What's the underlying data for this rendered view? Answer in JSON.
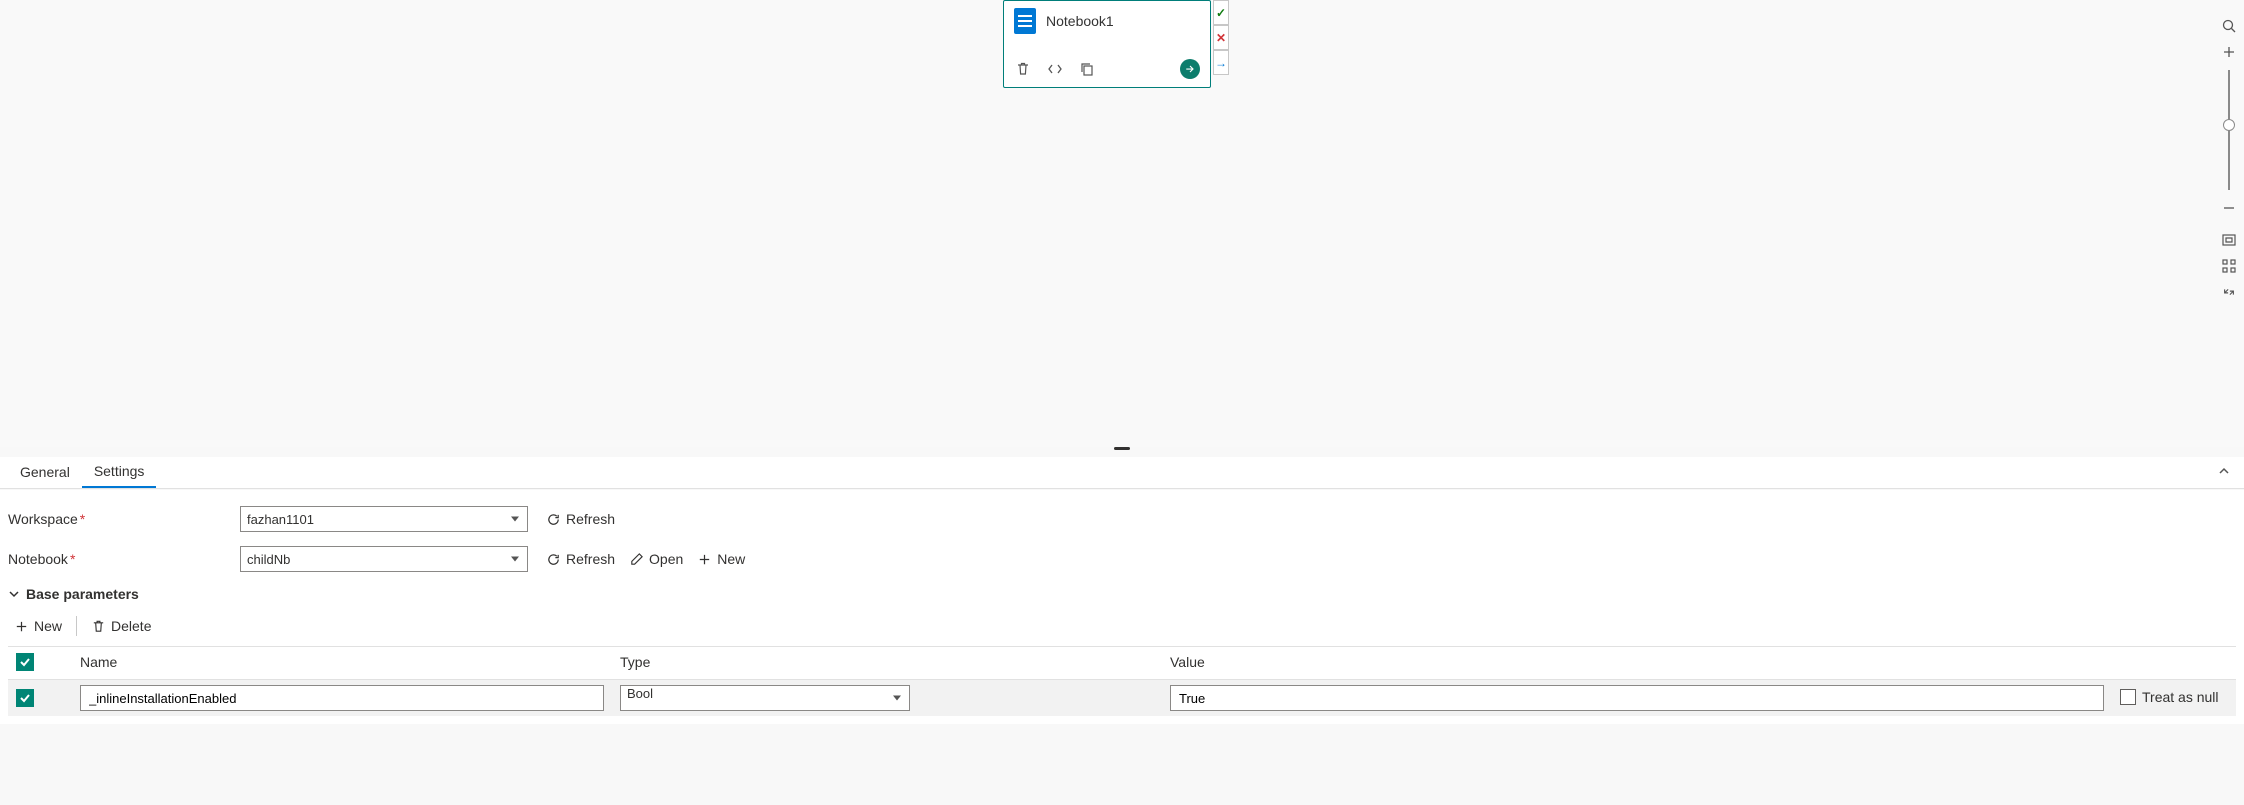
{
  "canvas": {
    "node_title": "Notebook1"
  },
  "tabs": {
    "general": "General",
    "settings": "Settings",
    "active": "Settings"
  },
  "form": {
    "workspace_label": "Workspace",
    "workspace_value": "fazhan1101",
    "notebook_label": "Notebook",
    "notebook_value": "childNb",
    "refresh": "Refresh",
    "open": "Open",
    "new": "New"
  },
  "params": {
    "section_title": "Base parameters",
    "new": "New",
    "delete": "Delete",
    "headers": {
      "name": "Name",
      "type": "Type",
      "value": "Value"
    },
    "treat_as_null": "Treat as null",
    "rows": [
      {
        "checked": true,
        "name": "_inlineInstallationEnabled",
        "type": "Bool",
        "value": "True",
        "null": false
      }
    ]
  }
}
